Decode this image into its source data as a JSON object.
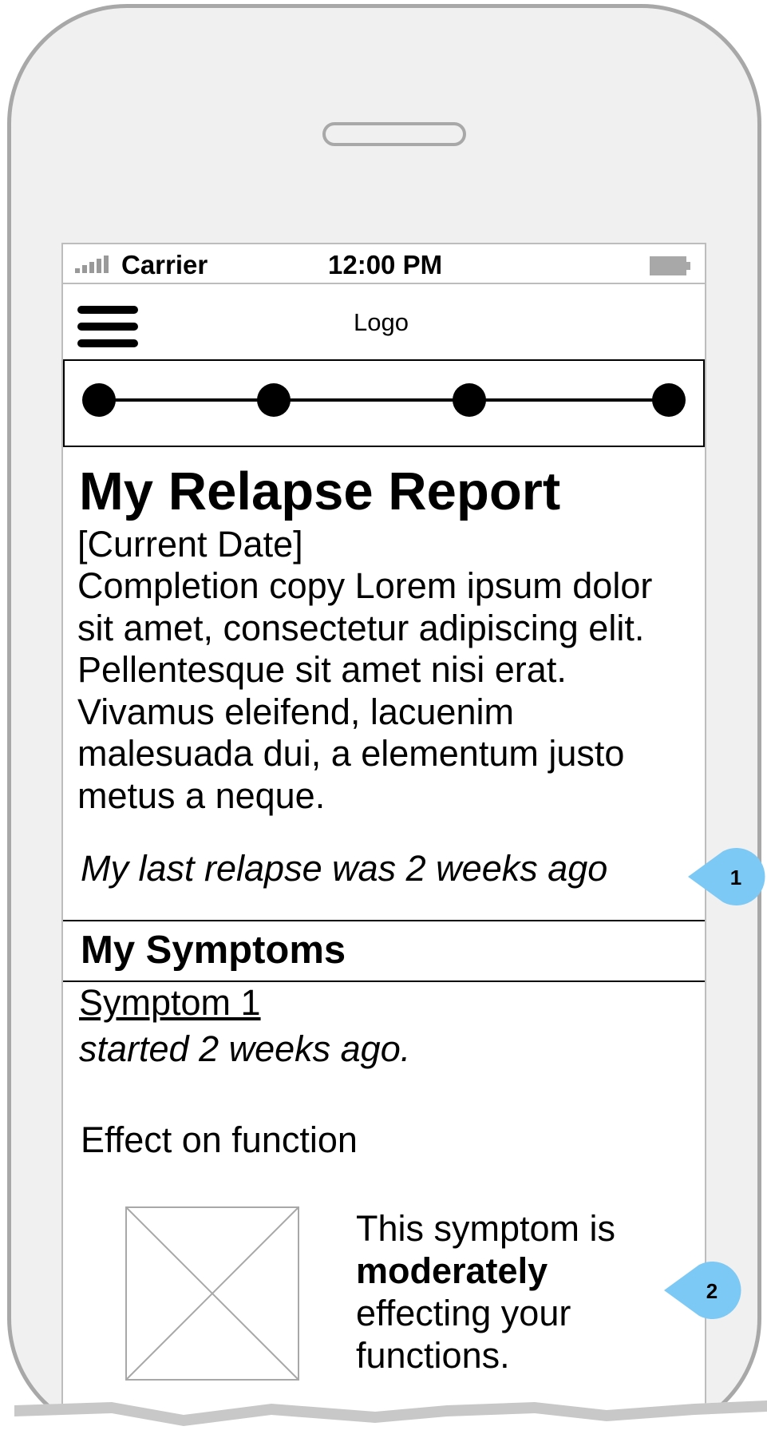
{
  "status_bar": {
    "carrier": "Carrier",
    "time": "12:00 PM"
  },
  "header": {
    "logo": "Logo",
    "menu_icon": "hamburger-menu-icon"
  },
  "progress": {
    "steps": 4
  },
  "report": {
    "title": "My Relapse Report",
    "date": "[Current Date]",
    "body": "Completion copy Lorem ipsum dolor sit amet, consectetur adipiscing elit. Pellentesque sit amet nisi erat. Vivamus eleifend, lacuenim malesuada dui, a elementum justo metus a neque.",
    "last_relapse": "My last relapse was 2 weeks ago"
  },
  "symptoms": {
    "heading": "My Symptoms",
    "items": [
      {
        "name": "Symptom 1",
        "started": "started 2 weeks ago.",
        "effect_label": "Effect on function",
        "severity_prefix": "This symptom is",
        "severity_level": "moderately",
        "severity_suffix": "effecting your functions."
      }
    ]
  },
  "callouts": [
    "1",
    "2"
  ],
  "colors": {
    "callout": "#7cc9f5",
    "device_frame": "#a8a8a8"
  }
}
